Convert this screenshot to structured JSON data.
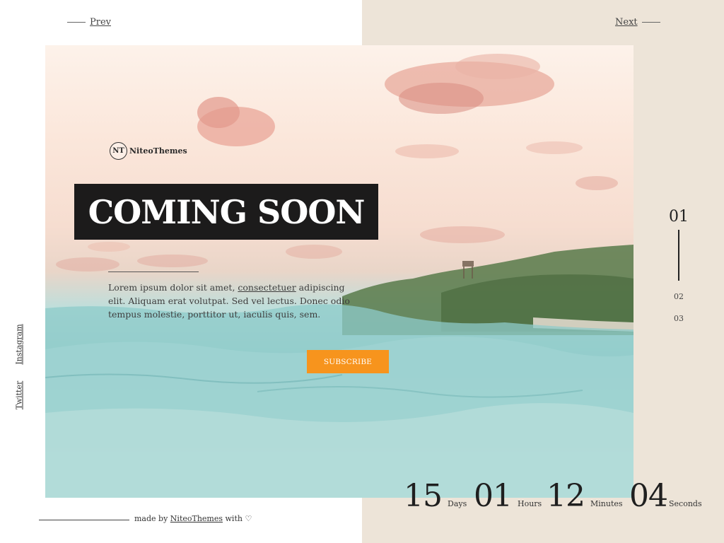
{
  "nav": {
    "prev": "Prev",
    "next": "Next"
  },
  "brand": {
    "logo_text": "NT",
    "name": "NiteoThemes"
  },
  "hero": {
    "title": "COMING SOON",
    "desc_before": "Lorem ipsum dolor sit amet, ",
    "desc_link": "consectetuer",
    "desc_after": " adipiscing elit. Aliquam erat volutpat. Sed vel lectus. Donec odio tempus molestie, porttitor ut, iaculis quis, sem."
  },
  "subscribe_label": "SUBSCRIBE",
  "slides": {
    "active": "01",
    "second": "02",
    "third": "03"
  },
  "social": {
    "instagram": "Instagram",
    "twitter": "Twitter"
  },
  "footer": {
    "made_by": "made by",
    "brand": "NiteoThemes",
    "with": "with",
    "heart": "♡"
  },
  "countdown": {
    "days": {
      "value": "15",
      "label": "Days"
    },
    "hours": {
      "value": "01",
      "label": "Hours"
    },
    "minutes": {
      "value": "12",
      "label": "Minutes"
    },
    "seconds": {
      "value": "04",
      "label": "Seconds"
    }
  },
  "colors": {
    "accent": "#f7941d",
    "title_bg": "#1c1b1b",
    "panel": "#ede4d8"
  }
}
